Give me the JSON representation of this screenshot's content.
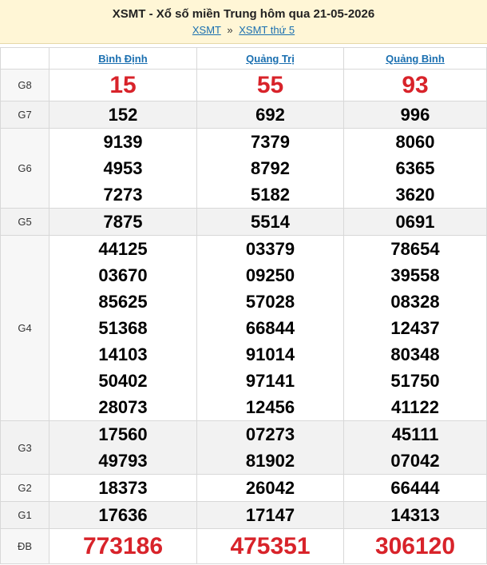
{
  "header": {
    "title": "XSMT - Xổ số miền Trung hôm qua 21-05-2026",
    "crumb1": "XSMT",
    "sep": "»",
    "crumb2": "XSMT thứ 5"
  },
  "provinces": [
    "Bình Định",
    "Quảng Trị",
    "Quảng Bình"
  ],
  "rows": [
    {
      "label": "G8",
      "cells": [
        [
          "15"
        ],
        [
          "55"
        ],
        [
          "93"
        ]
      ]
    },
    {
      "label": "G7",
      "cells": [
        [
          "152"
        ],
        [
          "692"
        ],
        [
          "996"
        ]
      ]
    },
    {
      "label": "G6",
      "cells": [
        [
          "9139",
          "4953",
          "7273"
        ],
        [
          "7379",
          "8792",
          "5182"
        ],
        [
          "8060",
          "6365",
          "3620"
        ]
      ]
    },
    {
      "label": "G5",
      "cells": [
        [
          "7875"
        ],
        [
          "5514"
        ],
        [
          "0691"
        ]
      ]
    },
    {
      "label": "G4",
      "cells": [
        [
          "44125",
          "03670",
          "85625",
          "51368",
          "14103",
          "50402",
          "28073"
        ],
        [
          "03379",
          "09250",
          "57028",
          "66844",
          "91014",
          "97141",
          "12456"
        ],
        [
          "78654",
          "39558",
          "08328",
          "12437",
          "80348",
          "51750",
          "41122"
        ]
      ]
    },
    {
      "label": "G3",
      "cells": [
        [
          "17560",
          "49793"
        ],
        [
          "07273",
          "81902"
        ],
        [
          "45111",
          "07042"
        ]
      ]
    },
    {
      "label": "G2",
      "cells": [
        [
          "18373"
        ],
        [
          "26042"
        ],
        [
          "66444"
        ]
      ]
    },
    {
      "label": "G1",
      "cells": [
        [
          "17636"
        ],
        [
          "17147"
        ],
        [
          "14313"
        ]
      ]
    },
    {
      "label": "ĐB",
      "cells": [
        [
          "773186"
        ],
        [
          "475351"
        ],
        [
          "306120"
        ]
      ]
    }
  ]
}
